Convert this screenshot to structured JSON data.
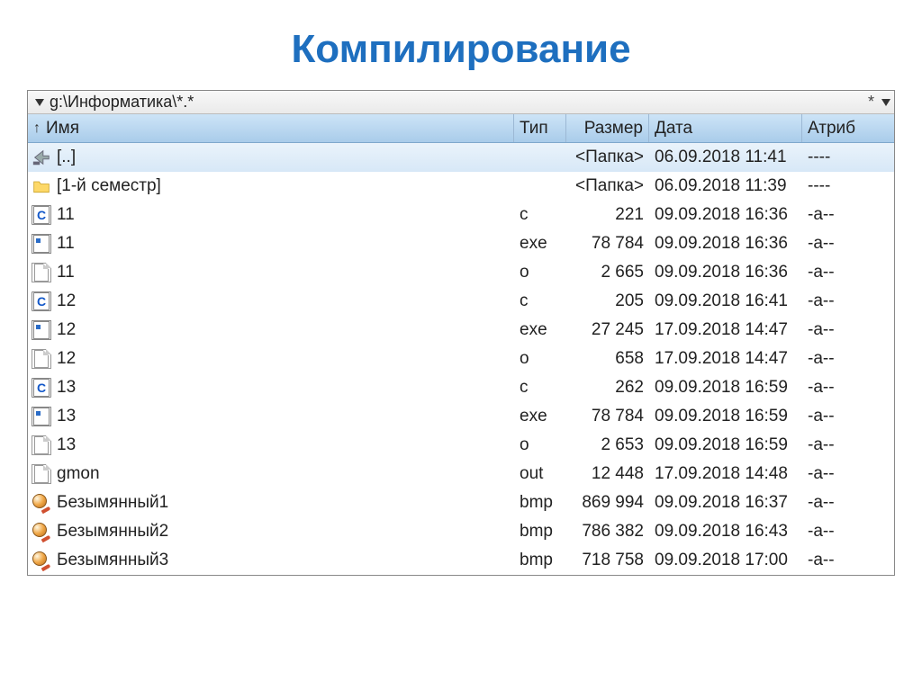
{
  "title": "Компилирование",
  "path": "g:\\Информатика\\*.*",
  "columns": {
    "name": "Имя",
    "type": "Тип",
    "size": "Размер",
    "date": "Дата",
    "attr": "Атриб"
  },
  "rows": [
    {
      "icon": "up",
      "name": "[..]",
      "type": "",
      "size": "<Папка>",
      "date": "06.09.2018 11:41",
      "attr": "----",
      "selected": true
    },
    {
      "icon": "folder",
      "name": "[1-й семестр]",
      "type": "",
      "size": "<Папка>",
      "date": "06.09.2018 11:39",
      "attr": "----"
    },
    {
      "icon": "c",
      "name": "11",
      "type": "c",
      "size": "221",
      "date": "09.09.2018 16:36",
      "attr": "-a--"
    },
    {
      "icon": "exe",
      "name": "11",
      "type": "exe",
      "size": "78 784",
      "date": "09.09.2018 16:36",
      "attr": "-a--"
    },
    {
      "icon": "blank",
      "name": "11",
      "type": "o",
      "size": "2 665",
      "date": "09.09.2018 16:36",
      "attr": "-a--"
    },
    {
      "icon": "c",
      "name": "12",
      "type": "c",
      "size": "205",
      "date": "09.09.2018 16:41",
      "attr": "-a--"
    },
    {
      "icon": "exe",
      "name": "12",
      "type": "exe",
      "size": "27 245",
      "date": "17.09.2018 14:47",
      "attr": "-a--"
    },
    {
      "icon": "blank",
      "name": "12",
      "type": "o",
      "size": "658",
      "date": "17.09.2018 14:47",
      "attr": "-a--"
    },
    {
      "icon": "c",
      "name": "13",
      "type": "c",
      "size": "262",
      "date": "09.09.2018 16:59",
      "attr": "-a--"
    },
    {
      "icon": "exe",
      "name": "13",
      "type": "exe",
      "size": "78 784",
      "date": "09.09.2018 16:59",
      "attr": "-a--"
    },
    {
      "icon": "blank",
      "name": "13",
      "type": "o",
      "size": "2 653",
      "date": "09.09.2018 16:59",
      "attr": "-a--"
    },
    {
      "icon": "blank",
      "name": "gmon",
      "type": "out",
      "size": "12 448",
      "date": "17.09.2018 14:48",
      "attr": "-a--"
    },
    {
      "icon": "bmp",
      "name": "Безымянный1",
      "type": "bmp",
      "size": "869 994",
      "date": "09.09.2018 16:37",
      "attr": "-a--"
    },
    {
      "icon": "bmp",
      "name": "Безымянный2",
      "type": "bmp",
      "size": "786 382",
      "date": "09.09.2018 16:43",
      "attr": "-a--"
    },
    {
      "icon": "bmp",
      "name": "Безымянный3",
      "type": "bmp",
      "size": "718 758",
      "date": "09.09.2018 17:00",
      "attr": "-a--"
    }
  ]
}
